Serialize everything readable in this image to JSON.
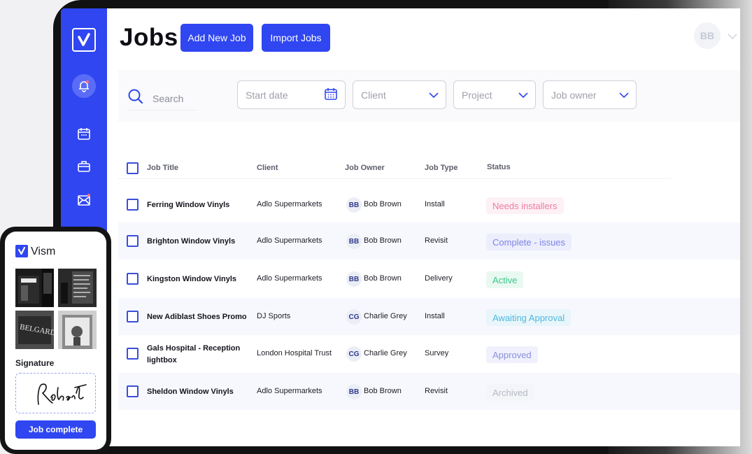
{
  "app": {
    "page_title": "Jobs",
    "add_job_label": "Add New Job",
    "import_jobs_label": "Import Jobs",
    "user_initials": "BB",
    "accent_color": "#2f46f1"
  },
  "sidebar": {
    "items": [
      {
        "icon": "logo-check-icon"
      },
      {
        "icon": "bell-icon"
      },
      {
        "icon": "calendar-icon"
      },
      {
        "icon": "briefcase-icon"
      },
      {
        "icon": "mail-icon"
      }
    ]
  },
  "filters": {
    "search_label": "Search",
    "start_date_placeholder": "Start date",
    "client_placeholder": "Client",
    "project_placeholder": "Project",
    "job_owner_placeholder": "Job owner"
  },
  "table": {
    "columns": [
      "Job Title",
      "Client",
      "Job Owner",
      "Job Type",
      "Status"
    ],
    "rows": [
      {
        "title": "Ferring Window Vinyls",
        "client": "Adlo Supermarkets",
        "owner_initials": "BB",
        "owner": "Bob Brown",
        "type": "Install",
        "status": "Needs installers",
        "status_color": "#f07aa0",
        "status_bg": "#fdf1f5"
      },
      {
        "title": "Brighton Window Vinyls",
        "client": "Adlo Supermarkets",
        "owner_initials": "BB",
        "owner": "Bob Brown",
        "type": "Revisit",
        "status": "Complete - issues",
        "status_color": "#7e82e6",
        "status_bg": "#eceefc"
      },
      {
        "title": "Kingston Window Vinyls",
        "client": "Adlo Supermarkets",
        "owner_initials": "BB",
        "owner": "Bob Brown",
        "type": "Delivery",
        "status": "Active",
        "status_color": "#36c98a",
        "status_bg": "#e9f9f1"
      },
      {
        "title": "New Adiblast Shoes Promo",
        "client": "DJ Sports",
        "owner_initials": "CG",
        "owner": "Charlie Grey",
        "type": "Install",
        "status": "Awaiting Approval",
        "status_color": "#4fb8dc",
        "status_bg": "#e8f6fb"
      },
      {
        "title": "Gals Hospital - Reception lightbox",
        "client": "London Hospital Trust",
        "owner_initials": "CG",
        "owner": "Charlie Grey",
        "type": "Survey",
        "status": "Approved",
        "status_color": "#8a8fe0",
        "status_bg": "#f0f1fc"
      },
      {
        "title": "Sheldon Window Vinyls",
        "client": "Adlo Supermarkets",
        "owner_initials": "BB",
        "owner": "Bob Brown",
        "type": "Revisit",
        "status": "Archived",
        "status_color": "#b5b8c4",
        "status_bg": "#f4f5f8"
      }
    ]
  },
  "phone": {
    "brand": "Vism",
    "signature_label": "Signature",
    "signature_text": "Robert",
    "job_complete_label": "Job complete"
  }
}
